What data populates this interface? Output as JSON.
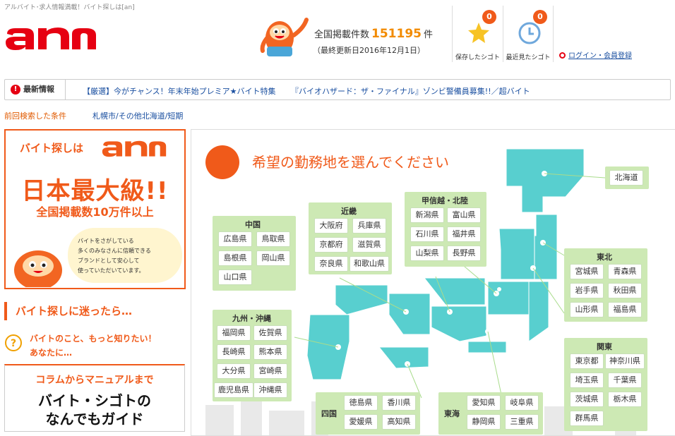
{
  "tagline": "アルバイト･求人情報満載！バイト探しは[an]",
  "header": {
    "count_prefix": "全国掲載件数",
    "count_value": "151195",
    "count_suffix": "件",
    "updated": "（最終更新日2016年12月1日）",
    "saved_label": "保存したシゴト",
    "saved_count": "0",
    "recent_label": "最近見たシゴト",
    "recent_count": "0",
    "login": "ログイン・会員登録"
  },
  "news": {
    "label": "最新情報",
    "items": [
      "【厳選】今がチャンス！年末年始プレミア★バイト特集",
      "『バイオハザード：ザ・ファイナル』ゾンビ警備員募集!!／超バイト"
    ]
  },
  "previous": {
    "label": "前回検索した条件",
    "link": "札幌市/その他北海道/短期"
  },
  "promo": {
    "heading": "バイト探しは",
    "big": "日本最大級!!",
    "sub": "全国掲載数10万件以上",
    "bubble": [
      "バイトをさがしている",
      "多くのみなさんに信頼できる",
      "ブランドとして安心して",
      "使っていただいています。"
    ]
  },
  "side": {
    "lost_heading": "バイト探しに迷ったら…",
    "lost_lines": [
      "バイトのこと、もっと知りたい！",
      "あなたに…"
    ],
    "guide_1": "コラムからマニュアルまで",
    "guide_2": "バイト・シゴトの",
    "guide_3": "なんでもガイド"
  },
  "map": {
    "title": "希望の勤務地を選んでください",
    "regions": {
      "hokkaido": {
        "prefs": [
          "北海道"
        ]
      },
      "tohoku": {
        "name": "東北",
        "prefs": [
          "宮城県",
          "青森県",
          "岩手県",
          "秋田県",
          "山形県",
          "福島県"
        ]
      },
      "kanto": {
        "name": "関東",
        "prefs": [
          "東京都",
          "神奈川県",
          "埼玉県",
          "千葉県",
          "茨城県",
          "栃木県",
          "群馬県"
        ]
      },
      "koshinetsu": {
        "name": "甲信越・北陸",
        "prefs": [
          "新潟県",
          "富山県",
          "石川県",
          "福井県",
          "山梨県",
          "長野県"
        ]
      },
      "kinki": {
        "name": "近畿",
        "prefs": [
          "大阪府",
          "兵庫県",
          "京都府",
          "滋賀県",
          "奈良県",
          "和歌山県"
        ]
      },
      "chugoku": {
        "name": "中国",
        "prefs": [
          "広島県",
          "鳥取県",
          "島根県",
          "岡山県",
          "山口県"
        ]
      },
      "kyushu": {
        "name": "九州・沖縄",
        "prefs": [
          "福岡県",
          "佐賀県",
          "長崎県",
          "熊本県",
          "大分県",
          "宮崎県",
          "鹿児島県",
          "沖縄県"
        ]
      },
      "shikoku": {
        "name": "四国",
        "prefs": [
          "徳島県",
          "香川県",
          "愛媛県",
          "高知県"
        ]
      },
      "tokai": {
        "name": "東海",
        "prefs": [
          "愛知県",
          "岐阜県",
          "静岡県",
          "三重県"
        ]
      }
    }
  },
  "colors": {
    "brand": "#f05a1a",
    "map_land": "#58cfcf",
    "region_bg": "#cde9b4",
    "link": "#1a4fa0"
  }
}
